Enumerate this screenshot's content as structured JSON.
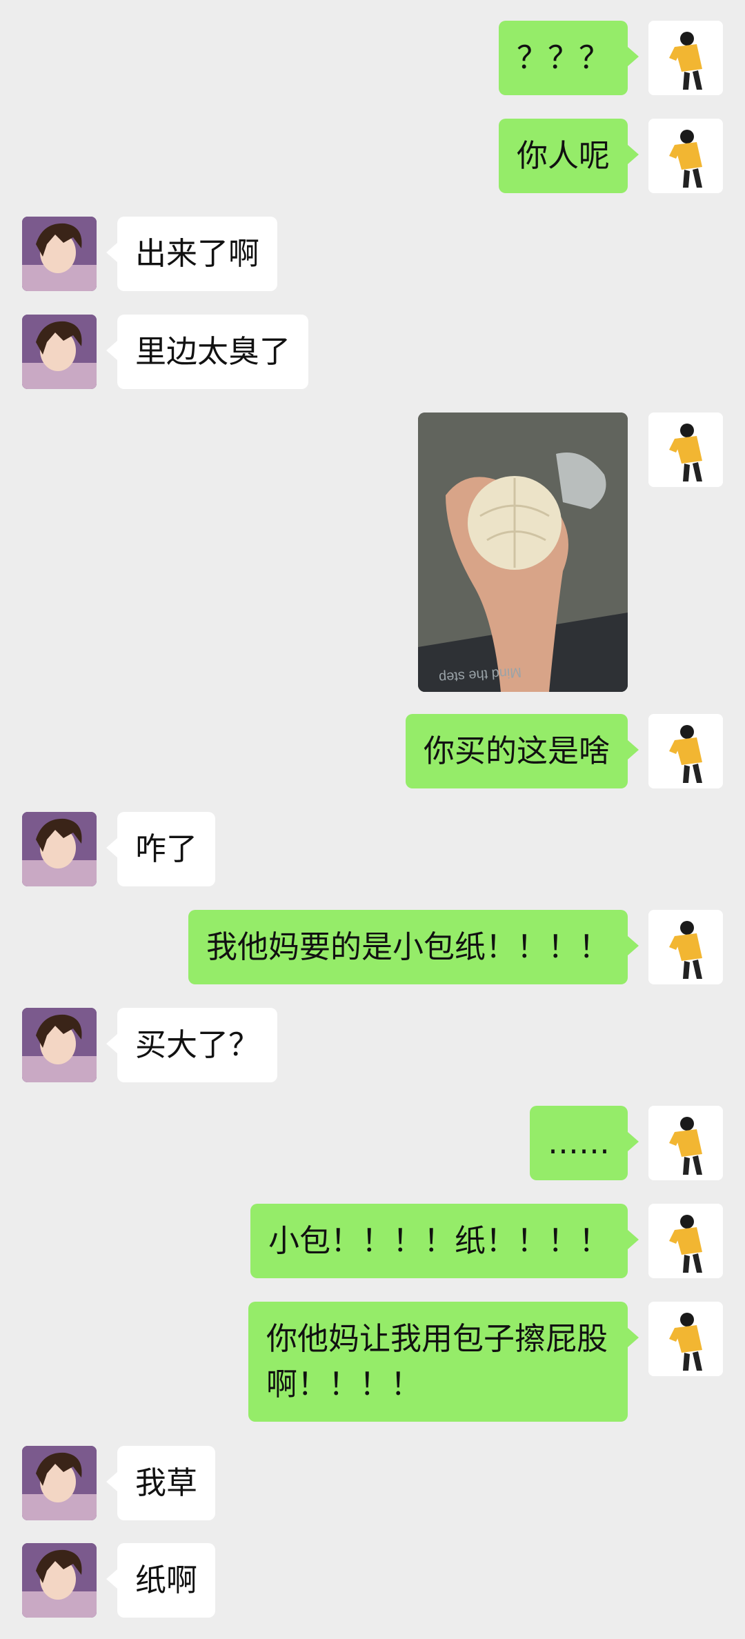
{
  "messages": [
    {
      "side": "right",
      "text": "？？？"
    },
    {
      "side": "right",
      "text": "你人呢"
    },
    {
      "side": "left",
      "text": "出来了啊"
    },
    {
      "side": "left",
      "text": "里边太臭了"
    },
    {
      "side": "right",
      "type": "image",
      "image_desc": "steamed-bun-photo",
      "floor_text": "Mind the step"
    },
    {
      "side": "right",
      "text": "你买的这是啥"
    },
    {
      "side": "left",
      "text": "咋了"
    },
    {
      "side": "right",
      "text": "我他妈要的是小包纸！！！！"
    },
    {
      "side": "left",
      "text": "买大了？"
    },
    {
      "side": "right",
      "text": "……"
    },
    {
      "side": "right",
      "text": "小包！！！！纸！！！！"
    },
    {
      "side": "right",
      "text": "你他妈让我用包子擦屁股啊！！！！"
    },
    {
      "side": "left",
      "text": "我草"
    },
    {
      "side": "left",
      "text": "纸啊"
    }
  ],
  "colors": {
    "background": "#ededed",
    "sent_bubble": "#95ec69",
    "received_bubble": "#ffffff"
  }
}
